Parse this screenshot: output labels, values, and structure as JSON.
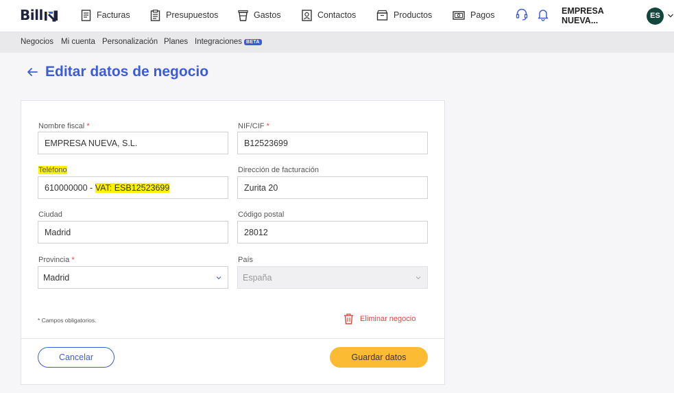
{
  "brand": {
    "name": "Bill",
    "accent": "#3d5bd8"
  },
  "topnav": {
    "items": [
      {
        "label": "Facturas",
        "icon": "invoice-icon"
      },
      {
        "label": "Presupuestos",
        "icon": "estimate-icon"
      },
      {
        "label": "Gastos",
        "icon": "expense-cup-icon"
      },
      {
        "label": "Contactos",
        "icon": "contact-icon"
      },
      {
        "label": "Productos",
        "icon": "product-box-icon"
      },
      {
        "label": "Pagos",
        "icon": "payment-icon"
      }
    ],
    "account_name": "EMPRESA NUEVA...",
    "avatar_initials": "ES"
  },
  "subnav": {
    "items": [
      "Negocios",
      "Mi cuenta",
      "Personalización",
      "Planes",
      "Integraciones"
    ],
    "beta_label": "BETA"
  },
  "page": {
    "title": "Editar datos de negocio"
  },
  "form": {
    "nombre_fiscal": {
      "label": "Nombre fiscal",
      "required_mark": "*",
      "value": "EMPRESA NUEVA, S.L."
    },
    "nif": {
      "label": "NIF/CIF",
      "required_mark": "*",
      "value": "B12523699"
    },
    "telefono": {
      "label": "Teléfono",
      "value_prefix": "610000000 - ",
      "value_highlight": "VAT: ESB12523699"
    },
    "direccion": {
      "label": "Dirección de facturación",
      "value": "Zurita 20"
    },
    "ciudad": {
      "label": "Ciudad",
      "value": "Madrid"
    },
    "codigo_postal": {
      "label": "Código postal",
      "value": "28012"
    },
    "provincia": {
      "label": "Provincia",
      "required_mark": "*",
      "value": "Madrid"
    },
    "pais": {
      "label": "País",
      "value": "España"
    },
    "required_note": "* Campos obligatorios.",
    "delete_label": "Eliminar negocio",
    "cancel_label": "Cancelar",
    "save_label": "Guardar datos"
  }
}
